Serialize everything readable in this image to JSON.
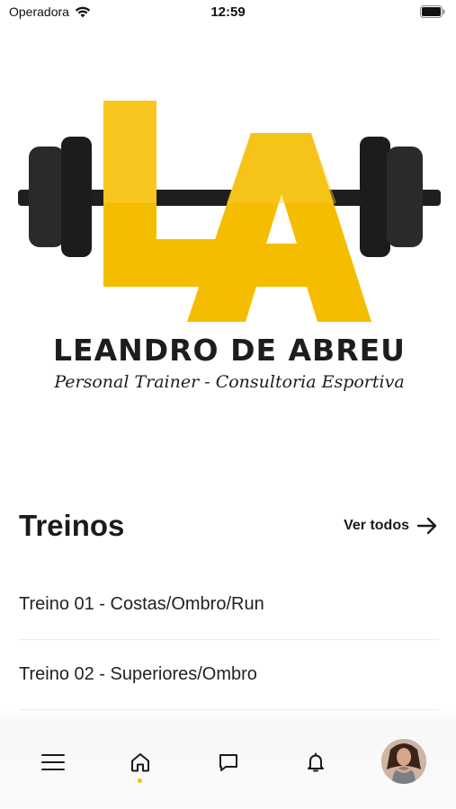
{
  "status_bar": {
    "carrier": "Operadora",
    "time": "12:59"
  },
  "logo": {
    "brand": "LEANDRO DE ABREU",
    "tagline": "Personal Trainer - Consultoria Esportiva"
  },
  "workouts": {
    "title": "Treinos",
    "see_all_label": "Ver todos",
    "items": [
      {
        "label": "Treino 01 - Costas/Ombro/Run"
      },
      {
        "label": "Treino 02 - Superiores/Ombro"
      }
    ]
  },
  "bottom_nav": {
    "items": [
      {
        "icon": "menu-icon"
      },
      {
        "icon": "home-icon",
        "active": true
      },
      {
        "icon": "chat-icon"
      },
      {
        "icon": "bell-icon"
      },
      {
        "icon": "avatar"
      }
    ],
    "active_indicator_color": "#f2c500"
  },
  "colors": {
    "accent": "#f5c000",
    "text": "#1b1b1b",
    "divider": "#ececec"
  }
}
